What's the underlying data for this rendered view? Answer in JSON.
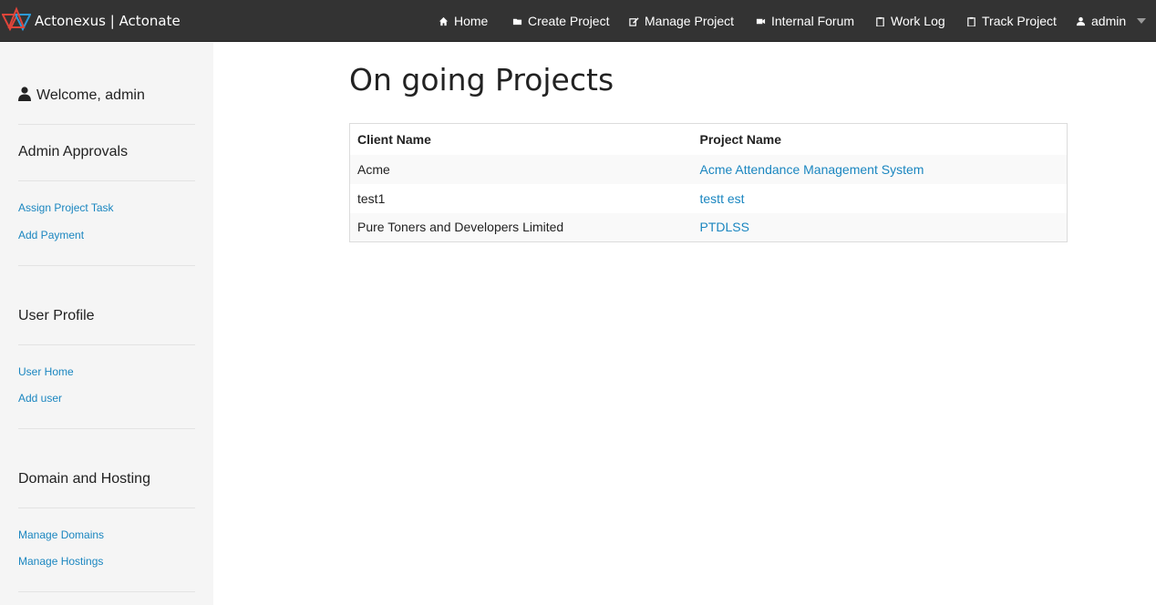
{
  "navbar": {
    "brand": "Actonexus | Actonate",
    "items": [
      {
        "label": "Home",
        "icon": "home-icon"
      },
      {
        "label": "Create Project",
        "icon": "folder-icon"
      },
      {
        "label": "Manage Project",
        "icon": "edit-icon"
      },
      {
        "label": "Internal Forum",
        "icon": "video-icon"
      },
      {
        "label": "Work Log",
        "icon": "clipboard-icon"
      },
      {
        "label": "Track Project",
        "icon": "clipboard-icon"
      }
    ],
    "user": {
      "label": "admin",
      "icon": "user-icon"
    }
  },
  "sidebar": {
    "welcome": "Welcome, admin",
    "sections": [
      {
        "heading": "Admin Approvals",
        "links": [
          "Assign Project Task",
          "Add Payment"
        ]
      },
      {
        "heading": "User Profile",
        "links": [
          "User Home",
          "Add user"
        ]
      },
      {
        "heading": "Domain and Hosting",
        "links": [
          "Manage Domains",
          "Manage Hostings"
        ]
      }
    ]
  },
  "main": {
    "title": "On going Projects",
    "table": {
      "columns": [
        "Client Name",
        "Project Name"
      ],
      "rows": [
        {
          "client": "Acme",
          "project": "Acme Attendance Management System"
        },
        {
          "client": "test1",
          "project": "testt est"
        },
        {
          "client": "Pure Toners and Developers Limited",
          "project": "PTDLSS"
        }
      ]
    }
  },
  "colors": {
    "navbar_bg": "#333333",
    "sidebar_bg": "#f5f5f5",
    "link": "#1a86c0",
    "logo_red": "#e0453a",
    "logo_blue": "#2c9ad6"
  }
}
